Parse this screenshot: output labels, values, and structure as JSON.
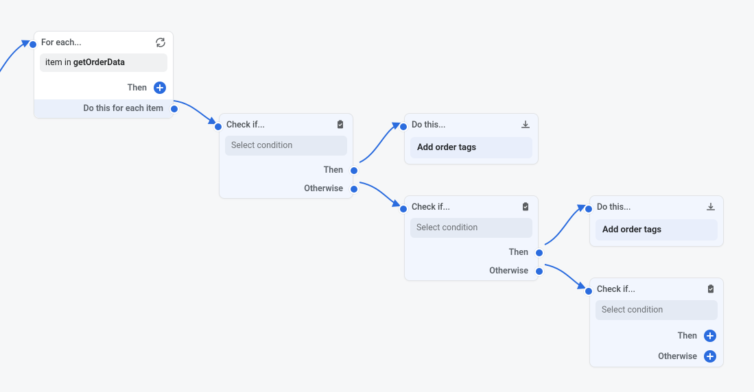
{
  "colors": {
    "accent": "#2b6cde"
  },
  "nodes": {
    "forEach": {
      "title": "For each...",
      "iterator_prefix": "item in ",
      "iterator_source": "getOrderData",
      "then_label": "Then",
      "loop_label": "Do this for each item"
    },
    "checkIf1": {
      "title": "Check if...",
      "placeholder": "Select condition",
      "then_label": "Then",
      "otherwise_label": "Otherwise"
    },
    "doThis1": {
      "title": "Do this...",
      "action_label": "Add order tags"
    },
    "checkIf2": {
      "title": "Check if...",
      "placeholder": "Select condition",
      "then_label": "Then",
      "otherwise_label": "Otherwise"
    },
    "doThis2": {
      "title": "Do this...",
      "action_label": "Add order tags"
    },
    "checkIf3": {
      "title": "Check if...",
      "placeholder": "Select condition",
      "then_label": "Then",
      "otherwise_label": "Otherwise"
    }
  }
}
